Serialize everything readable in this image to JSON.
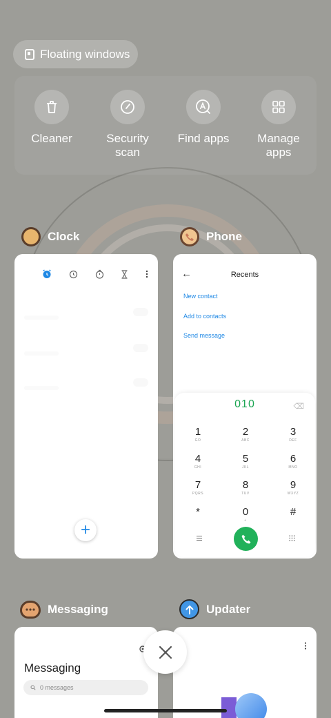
{
  "floating_windows": {
    "label": "Floating windows",
    "icon": "floating-window-icon"
  },
  "quick_actions": [
    {
      "label": "Cleaner",
      "icon": "trash-icon"
    },
    {
      "label": "Security\nscan",
      "icon": "security-scan-icon"
    },
    {
      "label": "Find apps",
      "icon": "find-apps-icon"
    },
    {
      "label": "Manage\napps",
      "icon": "grid-icon"
    }
  ],
  "recent_apps": [
    {
      "name": "Clock",
      "icon": "clock-app-icon"
    },
    {
      "name": "Phone",
      "icon": "phone-app-icon"
    },
    {
      "name": "Messaging",
      "icon": "messaging-app-icon"
    },
    {
      "name": "Updater",
      "icon": "updater-app-icon"
    }
  ],
  "clock_card": {
    "tabs": [
      "alarm-icon",
      "clock-icon",
      "stopwatch-icon",
      "timer-icon",
      "more-icon"
    ],
    "add_label": "+"
  },
  "phone_card": {
    "back": "←",
    "title": "Recents",
    "links": [
      "New contact",
      "Add to contacts",
      "Send message"
    ],
    "dialed": "010",
    "keys": [
      {
        "d": "1",
        "l": "GO"
      },
      {
        "d": "2",
        "l": "ABC"
      },
      {
        "d": "3",
        "l": "DEF"
      },
      {
        "d": "4",
        "l": "GHI"
      },
      {
        "d": "5",
        "l": "JKL"
      },
      {
        "d": "6",
        "l": "MNO"
      },
      {
        "d": "7",
        "l": "PQRS"
      },
      {
        "d": "8",
        "l": "TUV"
      },
      {
        "d": "9",
        "l": "WXYZ"
      },
      {
        "d": "*",
        "l": ""
      },
      {
        "d": "0",
        "l": "+"
      },
      {
        "d": "#",
        "l": ""
      }
    ]
  },
  "messaging_card": {
    "title": "Messaging",
    "search_placeholder": "0 messages"
  },
  "colors": {
    "accent_blue": "#1e88e5",
    "dial_green": "#21b15a",
    "background": "#9d9d98"
  }
}
